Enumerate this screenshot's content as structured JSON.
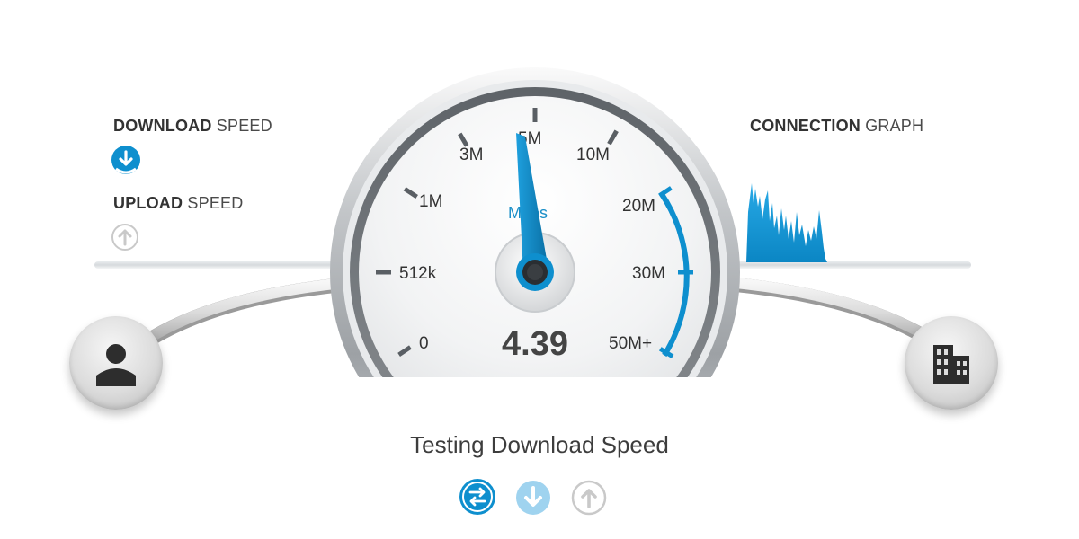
{
  "download": {
    "bold": "DOWNLOAD",
    "light": "SPEED",
    "icon": "download-arrow-icon"
  },
  "upload": {
    "bold": "UPLOAD",
    "light": "SPEED",
    "icon": "upload-arrow-icon"
  },
  "graph": {
    "bold": "CONNECTION",
    "light": "GRAPH"
  },
  "gauge": {
    "unit": "Mbps",
    "value": "4.39",
    "tick_labels": [
      "0",
      "512k",
      "1M",
      "3M",
      "5M",
      "10M",
      "20M",
      "30M",
      "50M+"
    ],
    "needle_mbps": 4.39
  },
  "status": "Testing Download Speed",
  "steps": [
    {
      "icon": "ping-exchange-icon",
      "state": "active"
    },
    {
      "icon": "download-arrow-icon",
      "state": "pending"
    },
    {
      "icon": "upload-arrow-icon",
      "state": "idle"
    }
  ],
  "colors": {
    "accent": "#0e8fce",
    "accent_light": "#9fd3ef",
    "muted": "#c9c9c9",
    "dark": "#353535"
  }
}
